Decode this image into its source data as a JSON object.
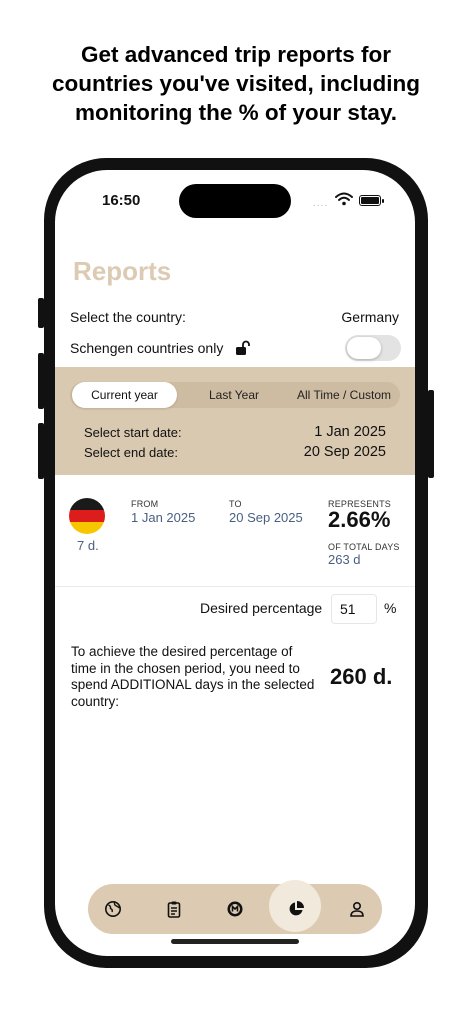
{
  "headline": {
    "line1": "Get advanced trip reports for",
    "line2": "countries you've visited, including",
    "line3": "monitoring the % of your stay."
  },
  "status_bar": {
    "time": "16:50",
    "dots": "...."
  },
  "page_title": "Reports",
  "country_select": {
    "label": "Select the country:",
    "value": "Germany"
  },
  "schengen": {
    "label": "Schengen countries only",
    "enabled": false
  },
  "period_tabs": [
    {
      "label": "Current year",
      "active": true
    },
    {
      "label": "Last Year",
      "active": false
    },
    {
      "label": "All Time / Custom",
      "active": false
    }
  ],
  "dates": {
    "start_label": "Select start date:",
    "start_value": "1 Jan 2025",
    "end_label": "Select end date:",
    "end_value": "20 Sep 2025"
  },
  "trip": {
    "country_flag": "germany-flag",
    "days": "7 d.",
    "from_label": "FROM",
    "from_value": "1 Jan 2025",
    "to_label": "TO",
    "to_value": "20 Sep 2025",
    "represents_label": "REPRESENTS",
    "percent": "2.66%",
    "total_label": "OF TOTAL DAYS",
    "total_value": "263 d"
  },
  "desired": {
    "label": "Desired percentage",
    "value": "51",
    "unit": "%"
  },
  "result": {
    "text": "To achieve the desired percentage of time in the chosen period, you need to spend ADDITIONAL days in the selected country:",
    "value": "260 d."
  },
  "tab_bar": [
    {
      "icon": "globe-icon",
      "active": false
    },
    {
      "icon": "clipboard-icon",
      "active": false
    },
    {
      "icon": "passport-stamp-icon",
      "active": false
    },
    {
      "icon": "pie-chart-icon",
      "active": true
    },
    {
      "icon": "person-icon",
      "active": false
    }
  ],
  "colors": {
    "accent": "#d9c9b0",
    "title": "#dccbb2",
    "link_blue": "#4a5f80"
  }
}
